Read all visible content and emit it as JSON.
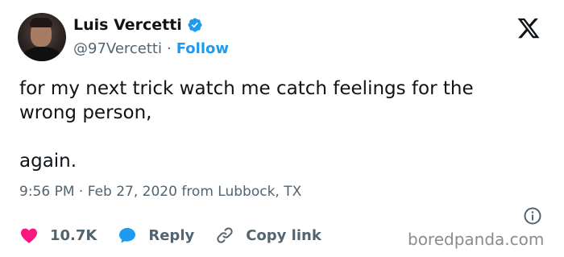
{
  "author": {
    "display_name": "Luis Vercetti",
    "handle": "@97Vercetti",
    "separator": "·",
    "follow_label": "Follow"
  },
  "tweet": {
    "text": "for my next trick watch me catch feelings for the\nwrong person,\n\nagain.",
    "time": "9:56 PM",
    "separator": " · ",
    "date_location": "Feb 27, 2020 from Lubbock, TX"
  },
  "actions": {
    "like_count": "10.7K",
    "reply_label": "Reply",
    "copy_link_label": "Copy link"
  },
  "watermark": "boredpanda.com",
  "icons": {
    "verified": "verified-badge-icon",
    "logo": "x-logo-icon",
    "info": "info-icon",
    "like": "heart-icon",
    "reply": "speech-bubble-icon",
    "copy_link": "link-icon"
  },
  "colors": {
    "accent": "#1d9bf0",
    "like": "#f91880",
    "text": "#0f1419",
    "muted": "#536471"
  }
}
